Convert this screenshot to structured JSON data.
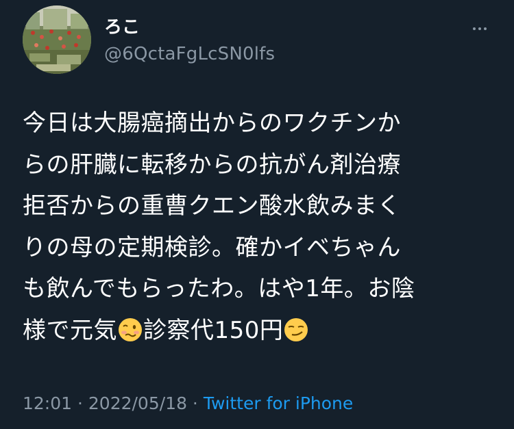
{
  "author": {
    "display_name": "ろこ",
    "handle": "@6QctaFgLcSN0lfs"
  },
  "tweet": {
    "lines": [
      "今日は大腸癌摘出からのワクチンか",
      "らの肝臓に転移からの抗がん剤治療",
      "拒否からの重曹クエン酸水飲みまく",
      "りの母の定期検診。確かイベちゃん",
      "も飲んでもらったわ。はや1年。お陰"
    ],
    "last_line": {
      "part1": "様で元気",
      "part2": "診察代150円"
    },
    "emoji": [
      "woozy-face",
      "smirking-face"
    ]
  },
  "meta": {
    "time": "12:01",
    "sep1": " · ",
    "date": "2022/05/18",
    "sep2": " · ",
    "source": "Twitter for iPhone"
  },
  "colors": {
    "background": "#15202b",
    "text": "#ffffff",
    "secondary": "#8b98a5",
    "accent": "#1d9bf0"
  }
}
